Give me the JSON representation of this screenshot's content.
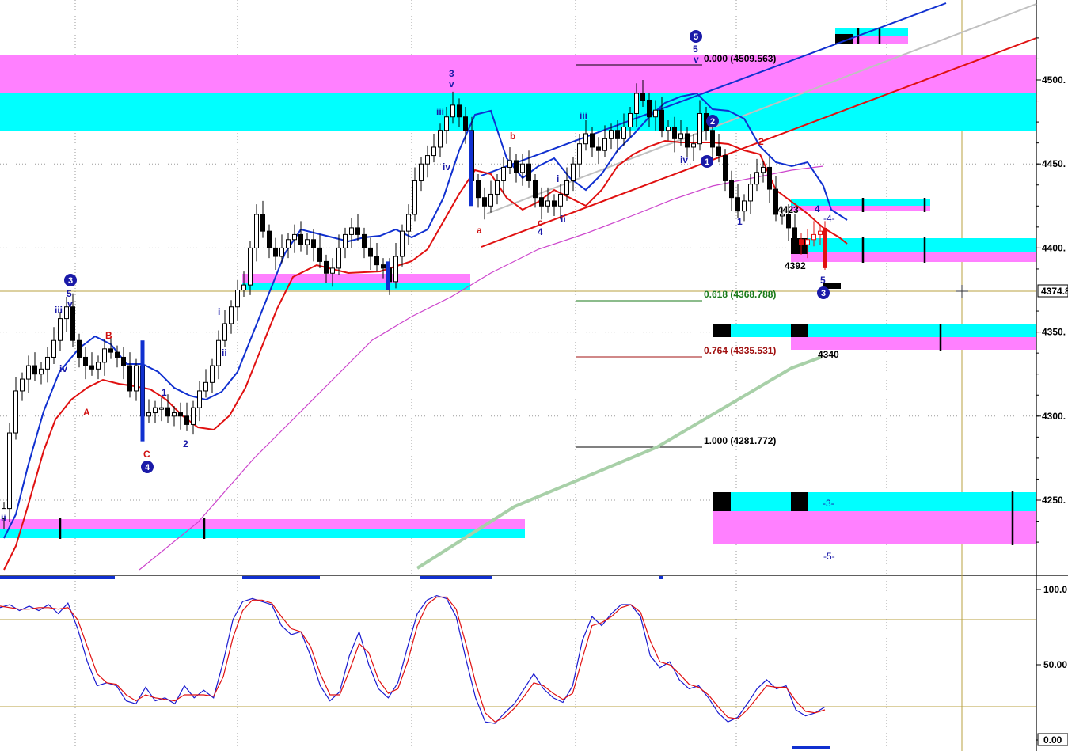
{
  "chart_data": [
    {
      "type": "candlestick",
      "title": "",
      "ylim": [
        4215,
        4530
      ],
      "y_tick_labels": [
        "4500.",
        "4450.",
        "4400.",
        "4350.",
        "4300.",
        "4250."
      ],
      "y_ticks": [
        4500,
        4450,
        4400,
        4350,
        4300,
        4250
      ],
      "last_price_label": "4374.8",
      "last_price": 4374.8,
      "fib_levels": [
        {
          "label": "0.000 (4509.563)",
          "value": 4509.563,
          "color": "#000000"
        },
        {
          "label": "0.618 (4368.788)",
          "value": 4368.788,
          "color": "#1a7a1a"
        },
        {
          "label": "0.764 (4335.531)",
          "value": 4335.531,
          "color": "#a01010"
        },
        {
          "label": "1.000 (4281.772)",
          "value": 4281.772,
          "color": "#000000"
        }
      ],
      "annotations": {
        "price_4392": "4392",
        "price_4340": "4340",
        "price_4423": "4423",
        "target_4": "4",
        "target_3": "-3-",
        "target_5": "-5-",
        "target_4b": "-4-"
      },
      "wave_labels_blue": [
        "ii",
        "iii",
        "iv",
        "5",
        "v",
        "3",
        "1",
        "2",
        "iii",
        "iv",
        "3",
        "v",
        "a",
        "4",
        "ii",
        "i",
        "iii",
        "5",
        "v",
        "iv",
        "1",
        "2",
        "1",
        "4",
        "5",
        "3",
        "i",
        "ii",
        "iii"
      ],
      "wave_labels_red": [
        "A",
        "B",
        "C",
        "a",
        "b",
        "c",
        "2"
      ],
      "circled_labels": [
        "3",
        "4",
        "5",
        "1",
        "2",
        "3"
      ],
      "colors": {
        "zone_cyan": "#00ffff",
        "zone_magenta": "#ff80ff",
        "ma_blue": "#1030d0",
        "ma_red": "#e01010",
        "ma_magenta": "#cc44cc",
        "ma_green": "#a8d0a8",
        "trend_blue": "#1030d0",
        "trend_red": "#e01010",
        "trend_gray": "#c0c0c0",
        "gridline": "#a0a0a0"
      }
    },
    {
      "type": "line",
      "title": "",
      "ylim": [
        0,
        100
      ],
      "y_tick_labels": [
        "100.0",
        "50.00",
        "0.00"
      ],
      "y_ticks": [
        100,
        50,
        0
      ],
      "reference_lines": [
        80,
        20
      ],
      "series": [
        {
          "name": "",
          "color": "#1a1ad0",
          "values": [
            88,
            90,
            86,
            89,
            86,
            90,
            84,
            91,
            74,
            52,
            36,
            38,
            36,
            26,
            24,
            35,
            26,
            28,
            24,
            36,
            28,
            33,
            28,
            52,
            80,
            92,
            94,
            92,
            90,
            76,
            70,
            72,
            56,
            36,
            26,
            32,
            56,
            72,
            50,
            34,
            28,
            38,
            62,
            84,
            93,
            96,
            94,
            82,
            54,
            28,
            12,
            11,
            18,
            24,
            34,
            44,
            34,
            28,
            25,
            36,
            66,
            82,
            76,
            84,
            90,
            90,
            82,
            56,
            48,
            52,
            40,
            34,
            36,
            28,
            18,
            12,
            15,
            24,
            34,
            40,
            34,
            36,
            20,
            16,
            18,
            22
          ]
        },
        {
          "name": "",
          "color": "#e01010",
          "values": [
            89,
            88,
            87,
            87,
            88,
            88,
            87,
            88,
            80,
            62,
            44,
            38,
            37,
            30,
            26,
            30,
            28,
            27,
            26,
            30,
            30,
            30,
            29,
            42,
            68,
            86,
            93,
            93,
            91,
            82,
            74,
            72,
            62,
            44,
            30,
            30,
            46,
            64,
            58,
            40,
            31,
            34,
            52,
            76,
            90,
            95,
            95,
            87,
            64,
            38,
            18,
            12,
            15,
            21,
            29,
            38,
            36,
            31,
            27,
            31,
            54,
            76,
            78,
            82,
            88,
            90,
            85,
            66,
            52,
            50,
            44,
            37,
            35,
            30,
            22,
            15,
            14,
            20,
            28,
            36,
            35,
            35,
            26,
            19,
            18,
            20
          ]
        }
      ]
    }
  ],
  "legend": {}
}
